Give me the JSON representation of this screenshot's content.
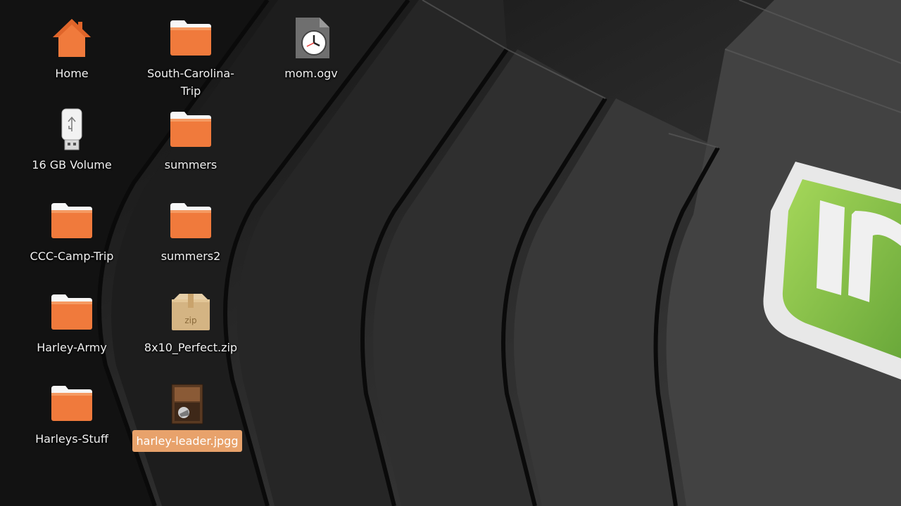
{
  "desktop": {
    "icons": [
      {
        "label": "Home",
        "type": "home-icon"
      },
      {
        "label": "South-Carolina-\nTrip",
        "type": "folder-icon"
      },
      {
        "label": "mom.ogv",
        "type": "video-file-icon"
      },
      {
        "label": "16 GB Volume",
        "type": "usb-drive-icon"
      },
      {
        "label": "summers",
        "type": "folder-icon"
      },
      {
        "label": "CCC-Camp-Trip",
        "type": "folder-icon"
      },
      {
        "label": "summers2",
        "type": "folder-icon"
      },
      {
        "label": "Harley-Army",
        "type": "folder-icon"
      },
      {
        "label": "8x10_Perfect.zip",
        "type": "zip-archive-icon"
      },
      {
        "label": "Harleys-Stuff",
        "type": "folder-icon"
      },
      {
        "label": "harley-leader.jpgg",
        "type": "image-file-icon"
      }
    ],
    "zip_badge": "zip",
    "colors": {
      "folder": "#f07a3c",
      "selection": "#e8a26b",
      "mint_green": "#8bc34a"
    }
  }
}
